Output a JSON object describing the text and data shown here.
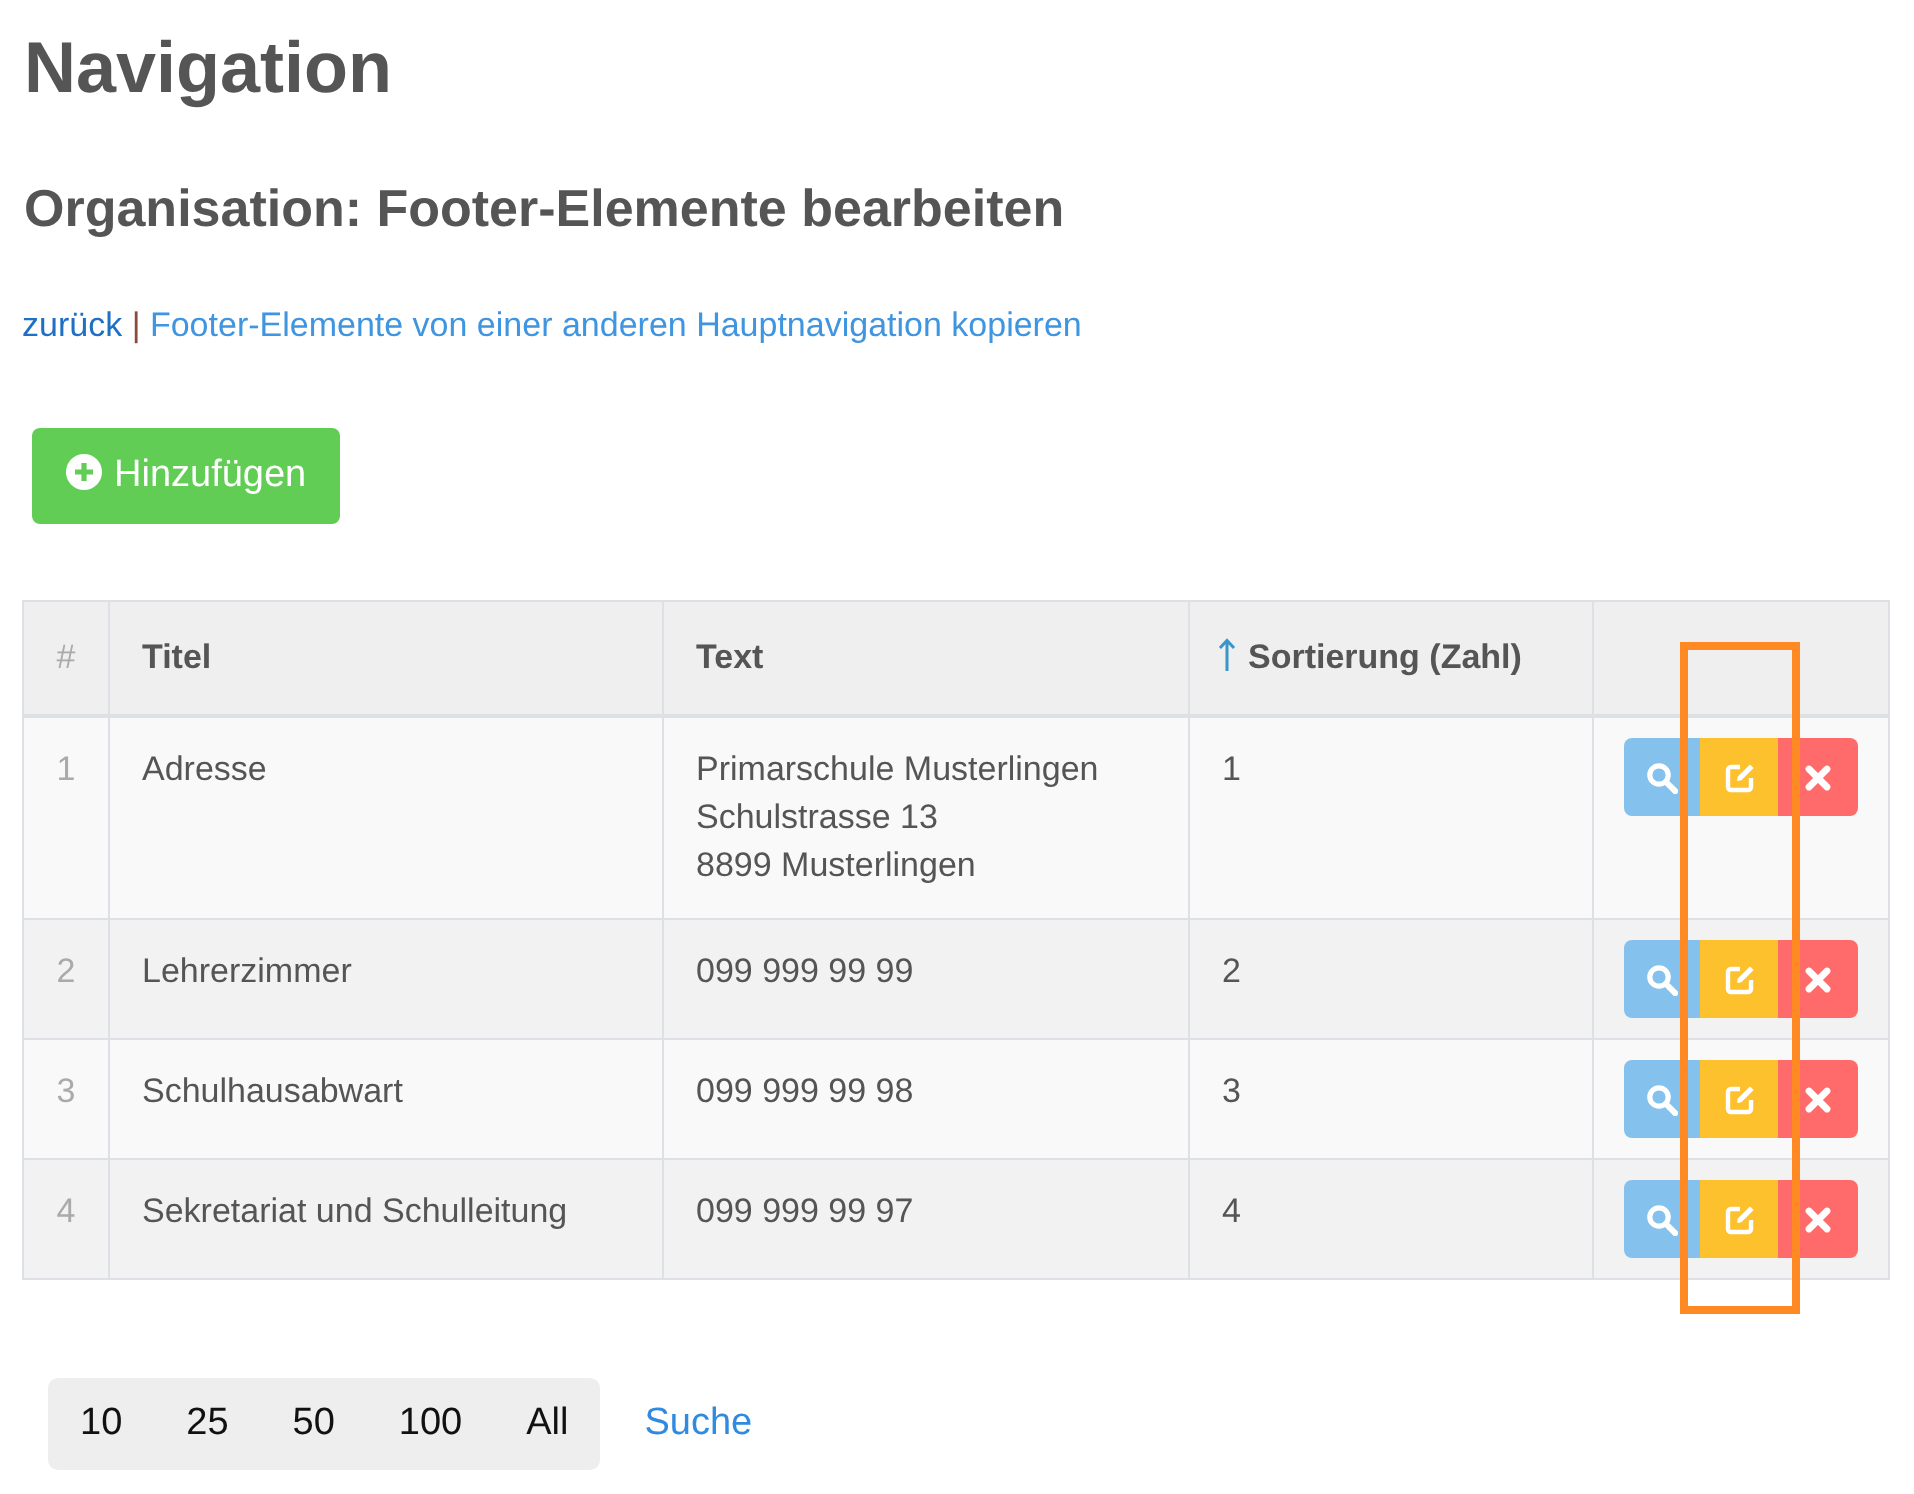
{
  "page": {
    "title": "Navigation",
    "subtitle": "Organisation: Footer-Elemente bearbeiten"
  },
  "links": {
    "back": "zurück",
    "separator": "|",
    "copy": "Footer-Elemente von einer anderen Hauptnavigation kopieren"
  },
  "add_button": {
    "label": "Hinzufügen"
  },
  "table": {
    "columns": [
      {
        "label": "#",
        "sorted": false
      },
      {
        "label": "Titel",
        "sorted": false
      },
      {
        "label": "Text",
        "sorted": false
      },
      {
        "label": "Sortierung (Zahl)",
        "sorted": true
      }
    ],
    "actions": [
      {
        "kind": "view",
        "highlighted": false
      },
      {
        "kind": "edit",
        "highlighted": true
      },
      {
        "kind": "delete",
        "highlighted": false
      }
    ],
    "rows": [
      {
        "number": "1",
        "title": "Adresse",
        "text": "Primarschule Musterlingen\nSchulstrasse 13\n8899 Musterlingen",
        "sort": "1"
      },
      {
        "number": "2",
        "title": "Lehrerzimmer",
        "text": "099 999 99 99",
        "sort": "2"
      },
      {
        "number": "3",
        "title": "Schulhausabwart",
        "text": "099 999 99 98",
        "sort": "3"
      },
      {
        "number": "4",
        "title": "Sekretariat und Schulleitung",
        "text": "099 999 99 97",
        "sort": "4"
      }
    ]
  },
  "page_length": {
    "options": [
      {
        "label": "10",
        "selected": false
      },
      {
        "label": "25",
        "selected": false
      },
      {
        "label": "50",
        "selected": false
      },
      {
        "label": "100",
        "selected": false
      },
      {
        "label": "All",
        "selected": false
      }
    ],
    "search": "Suche"
  }
}
